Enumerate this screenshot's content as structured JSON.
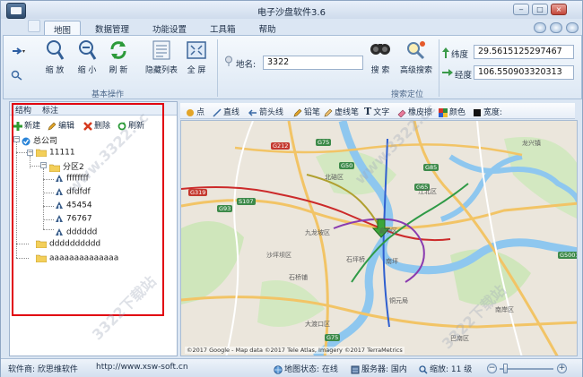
{
  "window": {
    "title": "电子沙盘软件3.6",
    "controls": [
      "‒",
      "□",
      "×"
    ]
  },
  "ribbon": {
    "tabs": [
      "地图",
      "数据管理",
      "功能设置",
      "工具箱",
      "帮助"
    ],
    "active_tab": "地图",
    "basic_ops": {
      "caption": "基本操作",
      "pan_label": "缩 放",
      "zoom_out_label": "缩 小",
      "refresh_label": "刷 新",
      "hide_list_label": "隐藏列表",
      "fullscreen_label": "全 屏"
    },
    "search": {
      "caption": "搜索定位",
      "place_label": "地名:",
      "place_value": "3322",
      "search_label": "搜 索",
      "advanced_label": "高级搜索"
    },
    "coords": {
      "lat_label": "纬度",
      "lat_value": "29.5615125297467",
      "lng_label": "经度",
      "lng_value": "106.550903320313"
    }
  },
  "left_panel": {
    "tabs": [
      "结构",
      "标注"
    ],
    "tools": [
      "新建",
      "编辑",
      "删除",
      "刷新"
    ],
    "tree": {
      "root": "总公司",
      "level1": "11111",
      "level2": "分区2",
      "leaves": [
        "ffffffff",
        "dfdfdf",
        "45454",
        "76767",
        "dddddd"
      ],
      "folders": [
        "dddddddddd",
        "aaaaaaaaaaaaaa"
      ]
    }
  },
  "map_toolbar": {
    "items": [
      "点",
      "直线",
      "箭头线",
      "铅笔",
      "虚线笔",
      "文字",
      "橡皮擦",
      "颜色",
      "宽度:"
    ]
  },
  "map": {
    "attribution": "©2017 Google - Map data ©2017 Tele Atlas, Imagery ©2017 TerraMetrics",
    "labels": [
      "G212",
      "G75",
      "G85",
      "G65",
      "G319",
      "S107",
      "G93",
      "G50",
      "G5001",
      "G75",
      "九龙坡区",
      "北碚区",
      "江北区",
      "渝中区",
      "南岸区",
      "巴南区",
      "大渡口区",
      "沙坪坝区",
      "石桥铺",
      "南坪",
      "石坪桥",
      "铜元局",
      "龙兴镇"
    ],
    "colors": {
      "water": "#8ec7ef",
      "land": "#ece7dd",
      "green": "#c9e4b4",
      "road_major": "#f2c466",
      "road_minor": "#ffffff",
      "metro_red": "#cc2a2a",
      "metro_blue": "#2f5fcf",
      "metro_green": "#2f9a46",
      "metro_purple": "#8a3bb0",
      "pin": "#3ca63a"
    }
  },
  "status": {
    "vendor": "软件商: 欣思维软件",
    "url": "http://www.xsw-soft.cn",
    "map_state": "地图状态: 在线",
    "server": "服务器: 国内",
    "zoom": "缩放: 11 级"
  },
  "watermarks": [
    "www.3322.cc",
    "3322下载站",
    "www.3322.cc",
    "3322下载站"
  ]
}
